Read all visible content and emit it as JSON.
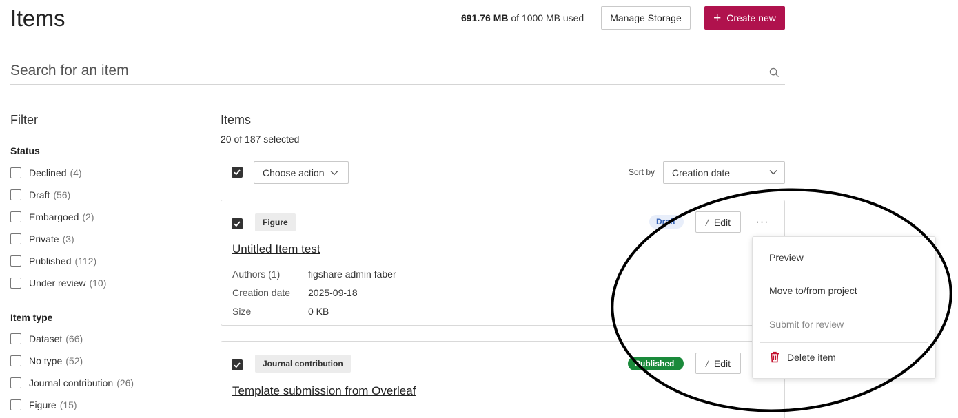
{
  "header": {
    "title": "Items",
    "storage": {
      "used": "691.76 MB",
      "total_text": "of 1000 MB used"
    },
    "manage_storage_label": "Manage Storage",
    "create_new_label": "Create new"
  },
  "search": {
    "placeholder": "Search for an item"
  },
  "filter": {
    "title": "Filter",
    "groups": [
      {
        "title": "Status",
        "items": [
          {
            "label": "Declined",
            "count": "(4)"
          },
          {
            "label": "Draft",
            "count": "(56)"
          },
          {
            "label": "Embargoed",
            "count": "(2)"
          },
          {
            "label": "Private",
            "count": "(3)"
          },
          {
            "label": "Published",
            "count": "(112)"
          },
          {
            "label": "Under review",
            "count": "(10)"
          }
        ]
      },
      {
        "title": "Item type",
        "items": [
          {
            "label": "Dataset",
            "count": "(66)"
          },
          {
            "label": "No type",
            "count": "(52)"
          },
          {
            "label": "Journal contribution",
            "count": "(26)"
          },
          {
            "label": "Figure",
            "count": "(15)"
          }
        ]
      }
    ]
  },
  "items": {
    "title": "Items",
    "selected_text": "20 of 187 selected",
    "choose_action_label": "Choose action",
    "sort_by_label": "Sort by",
    "sort_value": "Creation date",
    "cards": [
      {
        "type": "Figure",
        "status": "Draft",
        "title": "Untitled Item test",
        "edit_label": "Edit",
        "more_label": "···",
        "meta": [
          {
            "label": "Authors (1)",
            "value": "figshare admin faber"
          },
          {
            "label": "Creation date",
            "value": "2025-09-18"
          },
          {
            "label": "Size",
            "value": "0 KB"
          }
        ]
      },
      {
        "type": "Journal contribution",
        "status": "Published",
        "title": "Template submission from Overleaf",
        "edit_label": "Edit"
      }
    ]
  },
  "dropdown": {
    "items": [
      "Preview",
      "Move to/from project",
      "Submit for review"
    ],
    "delete_label": "Delete item"
  },
  "colors": {
    "brand": "#b0124d",
    "published": "#1a8a3b",
    "draft_text": "#3a66b7",
    "delete_icon": "#c4122f",
    "annotation": "#000000"
  }
}
